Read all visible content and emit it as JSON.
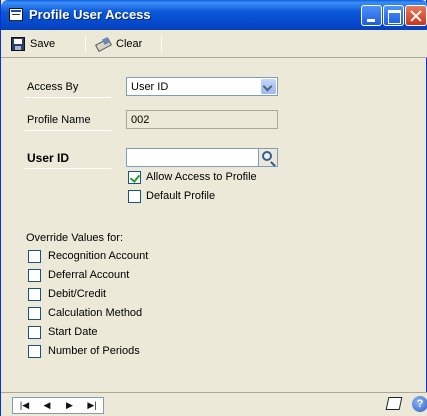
{
  "window": {
    "title": "Profile User Access"
  },
  "toolbar": {
    "save_label": "Save",
    "clear_label": "Clear"
  },
  "form": {
    "access_by_label": "Access By",
    "access_by_value": "User ID",
    "profile_name_label": "Profile Name",
    "profile_name_value": "002",
    "user_id_label": "User ID",
    "user_id_value": "",
    "allow_access_label": "Allow Access to Profile",
    "allow_access_checked": true,
    "default_profile_label": "Default Profile",
    "default_profile_checked": false
  },
  "overrides": {
    "header": "Override Values for:",
    "items": [
      {
        "label": "Recognition Account",
        "checked": false
      },
      {
        "label": "Deferral Account",
        "checked": false
      },
      {
        "label": "Debit/Credit",
        "checked": false
      },
      {
        "label": "Calculation Method",
        "checked": false
      },
      {
        "label": "Start Date",
        "checked": false
      },
      {
        "label": "Number of Periods",
        "checked": false
      }
    ]
  },
  "statusbar": {
    "nav_first": "|◀",
    "nav_prev": "◀",
    "nav_next": "▶",
    "nav_last": "▶|",
    "help_glyph": "?"
  },
  "colors": {
    "titlebar": "#0A58D8",
    "window_bg": "#ECE9D8",
    "field_border": "#7F9DB9",
    "check_green": "#21A121"
  }
}
